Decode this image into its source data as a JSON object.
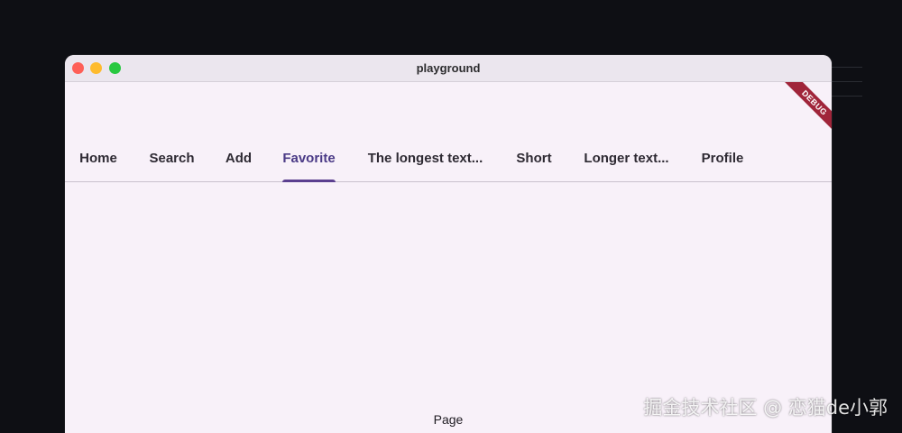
{
  "window": {
    "title": "playground"
  },
  "debug_banner": {
    "label": "DEBUG",
    "color": "#a0253a"
  },
  "tabs": [
    {
      "label": "Home",
      "active": false
    },
    {
      "label": "Search",
      "active": false
    },
    {
      "label": "Add",
      "active": false
    },
    {
      "label": "Favorite",
      "active": true
    },
    {
      "label": "The longest text...",
      "active": false
    },
    {
      "label": "Short",
      "active": false
    },
    {
      "label": "Longer text...",
      "active": false
    },
    {
      "label": "Profile",
      "active": false
    }
  ],
  "page": {
    "label": "Page"
  },
  "watermark": {
    "text": "掘金技术社区 @ 恋猫de小郭"
  },
  "colors": {
    "accent": "#5b3f8f",
    "background": "#f8f1f9",
    "tab_text": "#2e2a33"
  }
}
